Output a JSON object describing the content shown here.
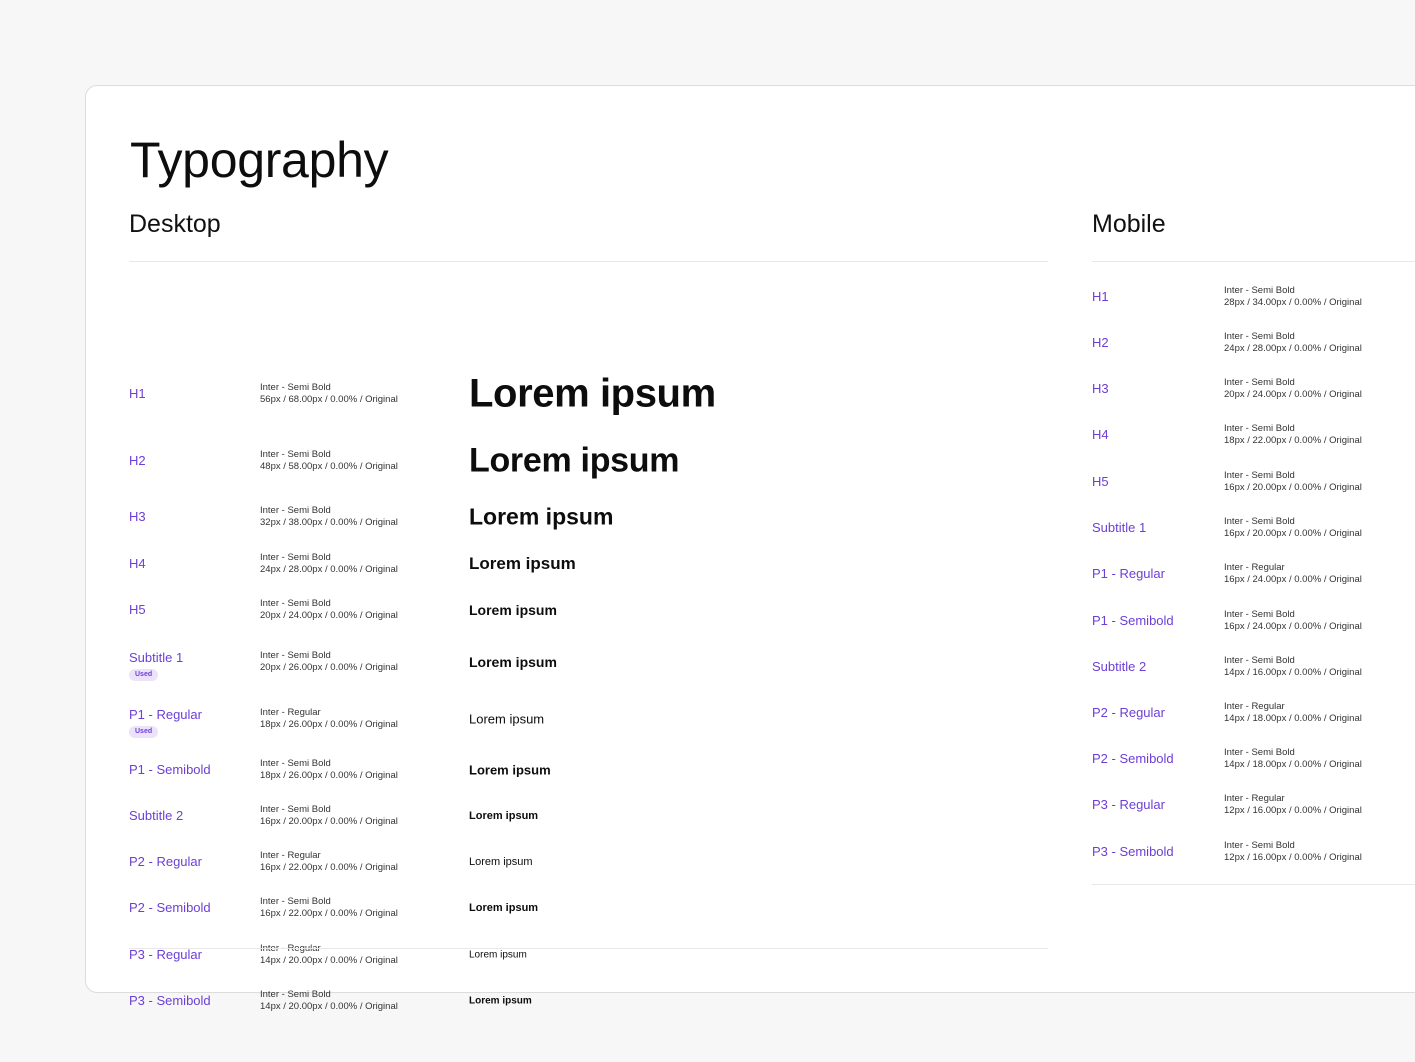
{
  "title": "Typography",
  "accent_color": "#6d3fd6",
  "badge_color": "#ece3fb",
  "desktop": {
    "heading": "Desktop",
    "rows": [
      {
        "name": "H1",
        "font": "Inter - Semi Bold",
        "metrics": "56px / 68.00px / 0.00% / Original",
        "sample": "Lorem ipsum",
        "badge": ""
      },
      {
        "name": "H2",
        "font": "Inter - Semi Bold",
        "metrics": "48px / 58.00px / 0.00% / Original",
        "sample": "Lorem ipsum",
        "badge": ""
      },
      {
        "name": "H3",
        "font": "Inter - Semi Bold",
        "metrics": "32px / 38.00px / 0.00% / Original",
        "sample": "Lorem ipsum",
        "badge": ""
      },
      {
        "name": "H4",
        "font": "Inter - Semi Bold",
        "metrics": "24px / 28.00px / 0.00% / Original",
        "sample": "Lorem ipsum",
        "badge": ""
      },
      {
        "name": "H5",
        "font": "Inter - Semi Bold",
        "metrics": "20px / 24.00px / 0.00% / Original",
        "sample": "Lorem ipsum",
        "badge": ""
      },
      {
        "name": "Subtitle 1",
        "font": "Inter - Semi Bold",
        "metrics": "20px / 26.00px / 0.00% / Original",
        "sample": "Lorem ipsum",
        "badge": "Used"
      },
      {
        "name": "P1 - Regular",
        "font": "Inter - Regular",
        "metrics": "18px / 26.00px / 0.00% / Original",
        "sample": "Lorem ipsum",
        "badge": "Used"
      },
      {
        "name": "P1 - Semibold",
        "font": "Inter - Semi Bold",
        "metrics": "18px / 26.00px / 0.00% / Original",
        "sample": "Lorem ipsum",
        "badge": ""
      },
      {
        "name": "Subtitle 2",
        "font": "Inter - Semi Bold",
        "metrics": "16px / 20.00px / 0.00% / Original",
        "sample": "Lorem ipsum",
        "badge": ""
      },
      {
        "name": "P2 - Regular",
        "font": "Inter - Regular",
        "metrics": "16px / 22.00px / 0.00% / Original",
        "sample": "Lorem ipsum",
        "badge": ""
      },
      {
        "name": "P2 - Semibold",
        "font": "Inter - Semi Bold",
        "metrics": "16px / 22.00px / 0.00% / Original",
        "sample": "Lorem ipsum",
        "badge": ""
      },
      {
        "name": "P3 - Regular",
        "font": "Inter - Regular",
        "metrics": "14px / 20.00px / 0.00% / Original",
        "sample": "Lorem ipsum",
        "badge": ""
      },
      {
        "name": "P3 - Semibold",
        "font": "Inter - Semi Bold",
        "metrics": "14px / 20.00px / 0.00% / Original",
        "sample": "Lorem ipsum",
        "badge": ""
      }
    ]
  },
  "mobile": {
    "heading": "Mobile",
    "rows": [
      {
        "name": "H1",
        "font": "Inter - Semi Bold",
        "metrics": "28px / 34.00px / 0.00% / Original"
      },
      {
        "name": "H2",
        "font": "Inter - Semi Bold",
        "metrics": "24px / 28.00px / 0.00% / Original"
      },
      {
        "name": "H3",
        "font": "Inter - Semi Bold",
        "metrics": "20px / 24.00px / 0.00% / Original"
      },
      {
        "name": "H4",
        "font": "Inter - Semi Bold",
        "metrics": "18px / 22.00px / 0.00% / Original"
      },
      {
        "name": "H5",
        "font": "Inter - Semi Bold",
        "metrics": "16px / 20.00px / 0.00% / Original"
      },
      {
        "name": "Subtitle 1",
        "font": "Inter - Semi Bold",
        "metrics": "16px / 20.00px / 0.00% / Original"
      },
      {
        "name": "P1 - Regular",
        "font": "Inter - Regular",
        "metrics": "16px / 24.00px / 0.00% / Original"
      },
      {
        "name": "P1 - Semibold",
        "font": "Inter - Semi Bold",
        "metrics": "16px / 24.00px / 0.00% / Original"
      },
      {
        "name": "Subtitle 2",
        "font": "Inter - Semi Bold",
        "metrics": "14px / 16.00px / 0.00% / Original"
      },
      {
        "name": "P2 - Regular",
        "font": "Inter - Regular",
        "metrics": "14px / 18.00px / 0.00% / Original"
      },
      {
        "name": "P2 - Semibold",
        "font": "Inter - Semi Bold",
        "metrics": "14px / 18.00px / 0.00% / Original"
      },
      {
        "name": "P3 - Regular",
        "font": "Inter - Regular",
        "metrics": "12px / 16.00px / 0.00% / Original"
      },
      {
        "name": "P3 - Semibold",
        "font": "Inter - Semi Bold",
        "metrics": "12px / 16.00px / 0.00% / Original"
      }
    ]
  }
}
